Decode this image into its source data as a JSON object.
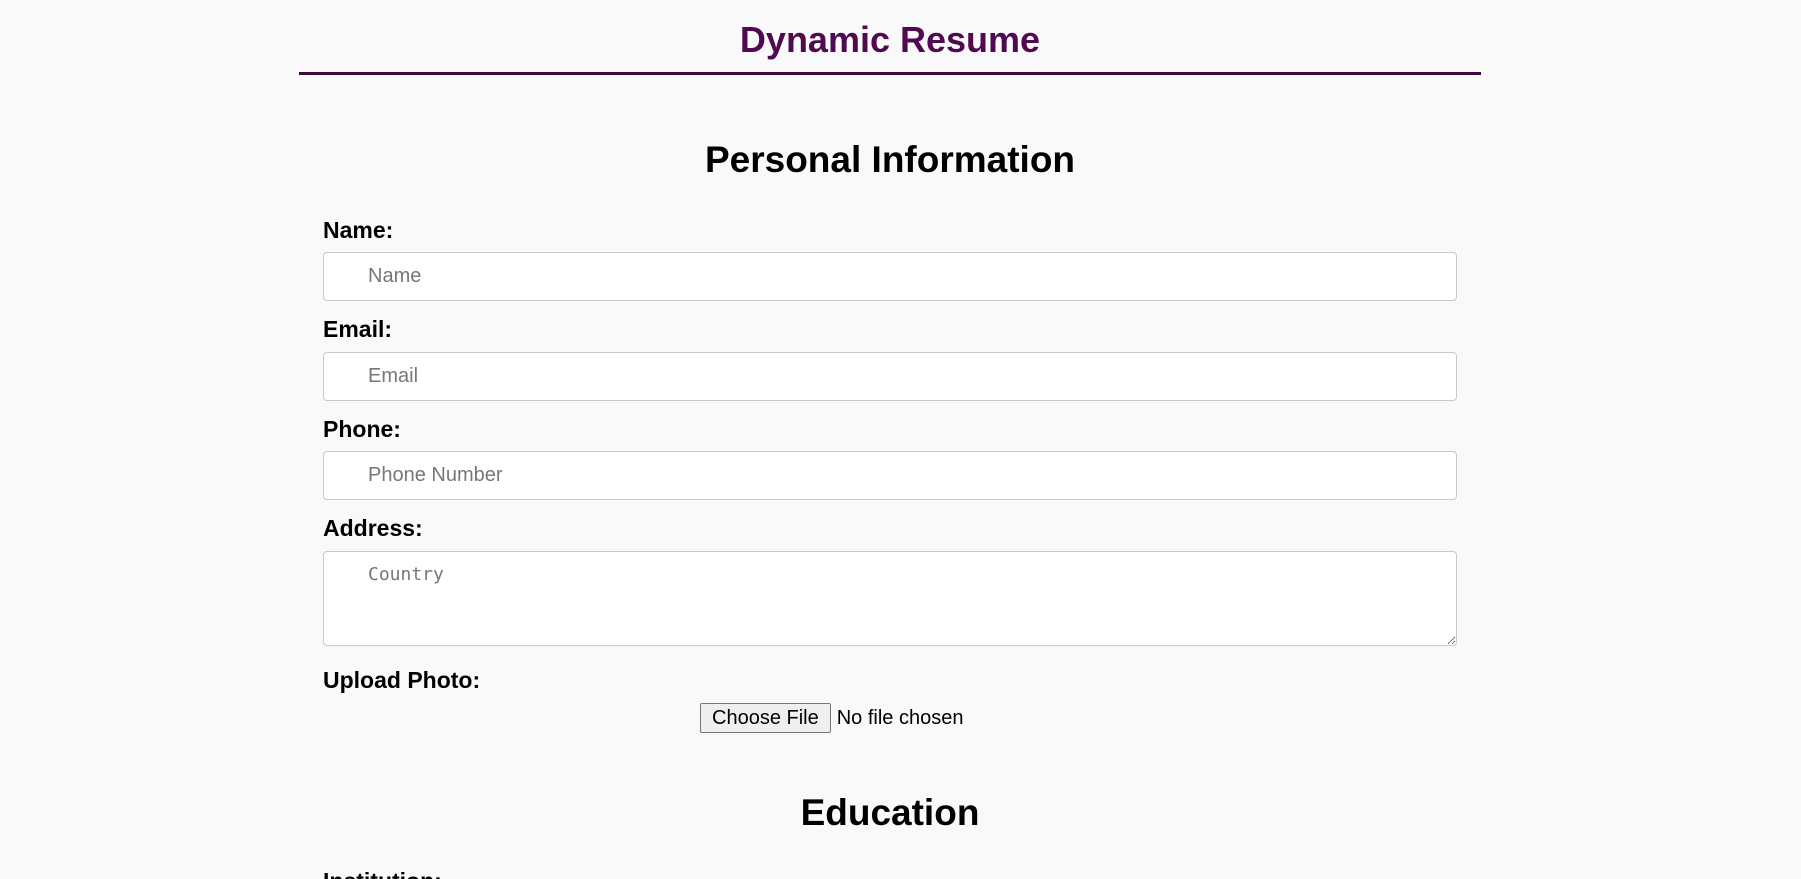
{
  "header": {
    "title": "Dynamic Resume"
  },
  "personal_info": {
    "title": "Personal Information",
    "fields": {
      "name": {
        "label": "Name:",
        "placeholder": "Name"
      },
      "email": {
        "label": "Email:",
        "placeholder": "Email"
      },
      "phone": {
        "label": "Phone:",
        "placeholder": "Phone Number"
      },
      "address": {
        "label": "Address:",
        "placeholder": "Country"
      }
    },
    "photo": {
      "label": "Upload Photo:",
      "button_label": "Choose File",
      "status": "No file chosen"
    }
  },
  "education": {
    "title": "Education",
    "institution_label": "Institution:"
  },
  "colors": {
    "header_title": "#500b50",
    "header_rule": "#3d0a3f",
    "background": "#f9f9f9"
  }
}
